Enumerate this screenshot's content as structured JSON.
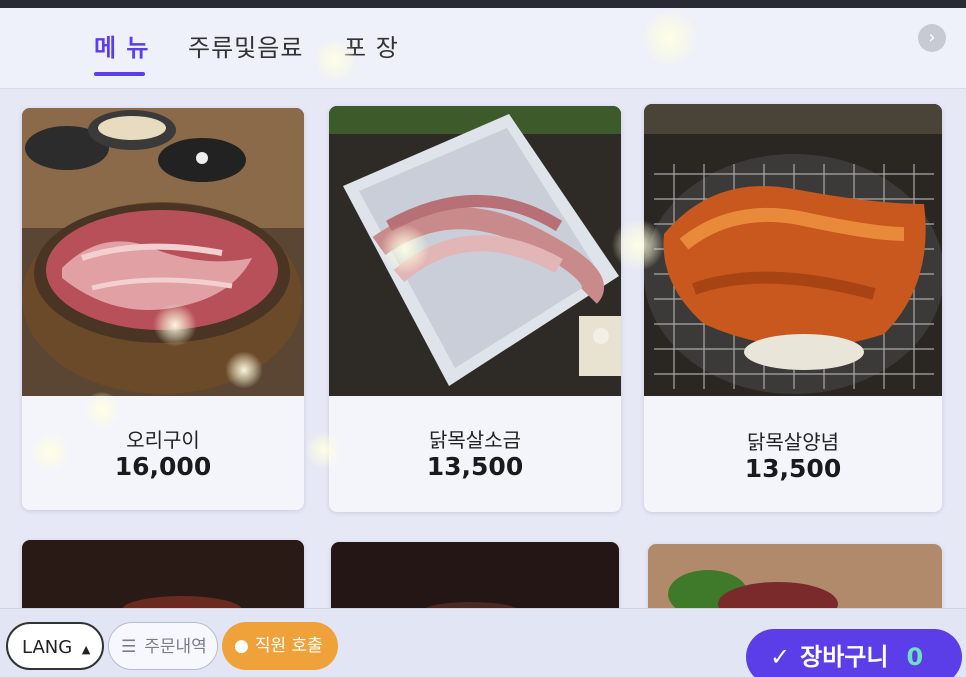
{
  "tabs": [
    {
      "label": "메 뉴",
      "active": true
    },
    {
      "label": "주류및음료",
      "active": false
    },
    {
      "label": "포 장",
      "active": false
    }
  ],
  "menu_items": [
    {
      "name": "오리구이",
      "price": "16,000",
      "photo_icon": "grilled-duck-photo"
    },
    {
      "name": "닭목살소금",
      "price": "13,500",
      "photo_icon": "salted-chicken-neck-photo"
    },
    {
      "name": "닭목살양념",
      "price": "13,500",
      "photo_icon": "seasoned-chicken-neck-photo"
    }
  ],
  "footer": {
    "lang_label": "LANG",
    "order_history_label": "주문내역",
    "staff_call_label": "직원 호출",
    "cart_label": "장바구니",
    "cart_count": "0"
  },
  "colors": {
    "accent": "#5b3ee8",
    "staff_call": "#f0a23a",
    "cart_count": "#6ee0c0"
  }
}
